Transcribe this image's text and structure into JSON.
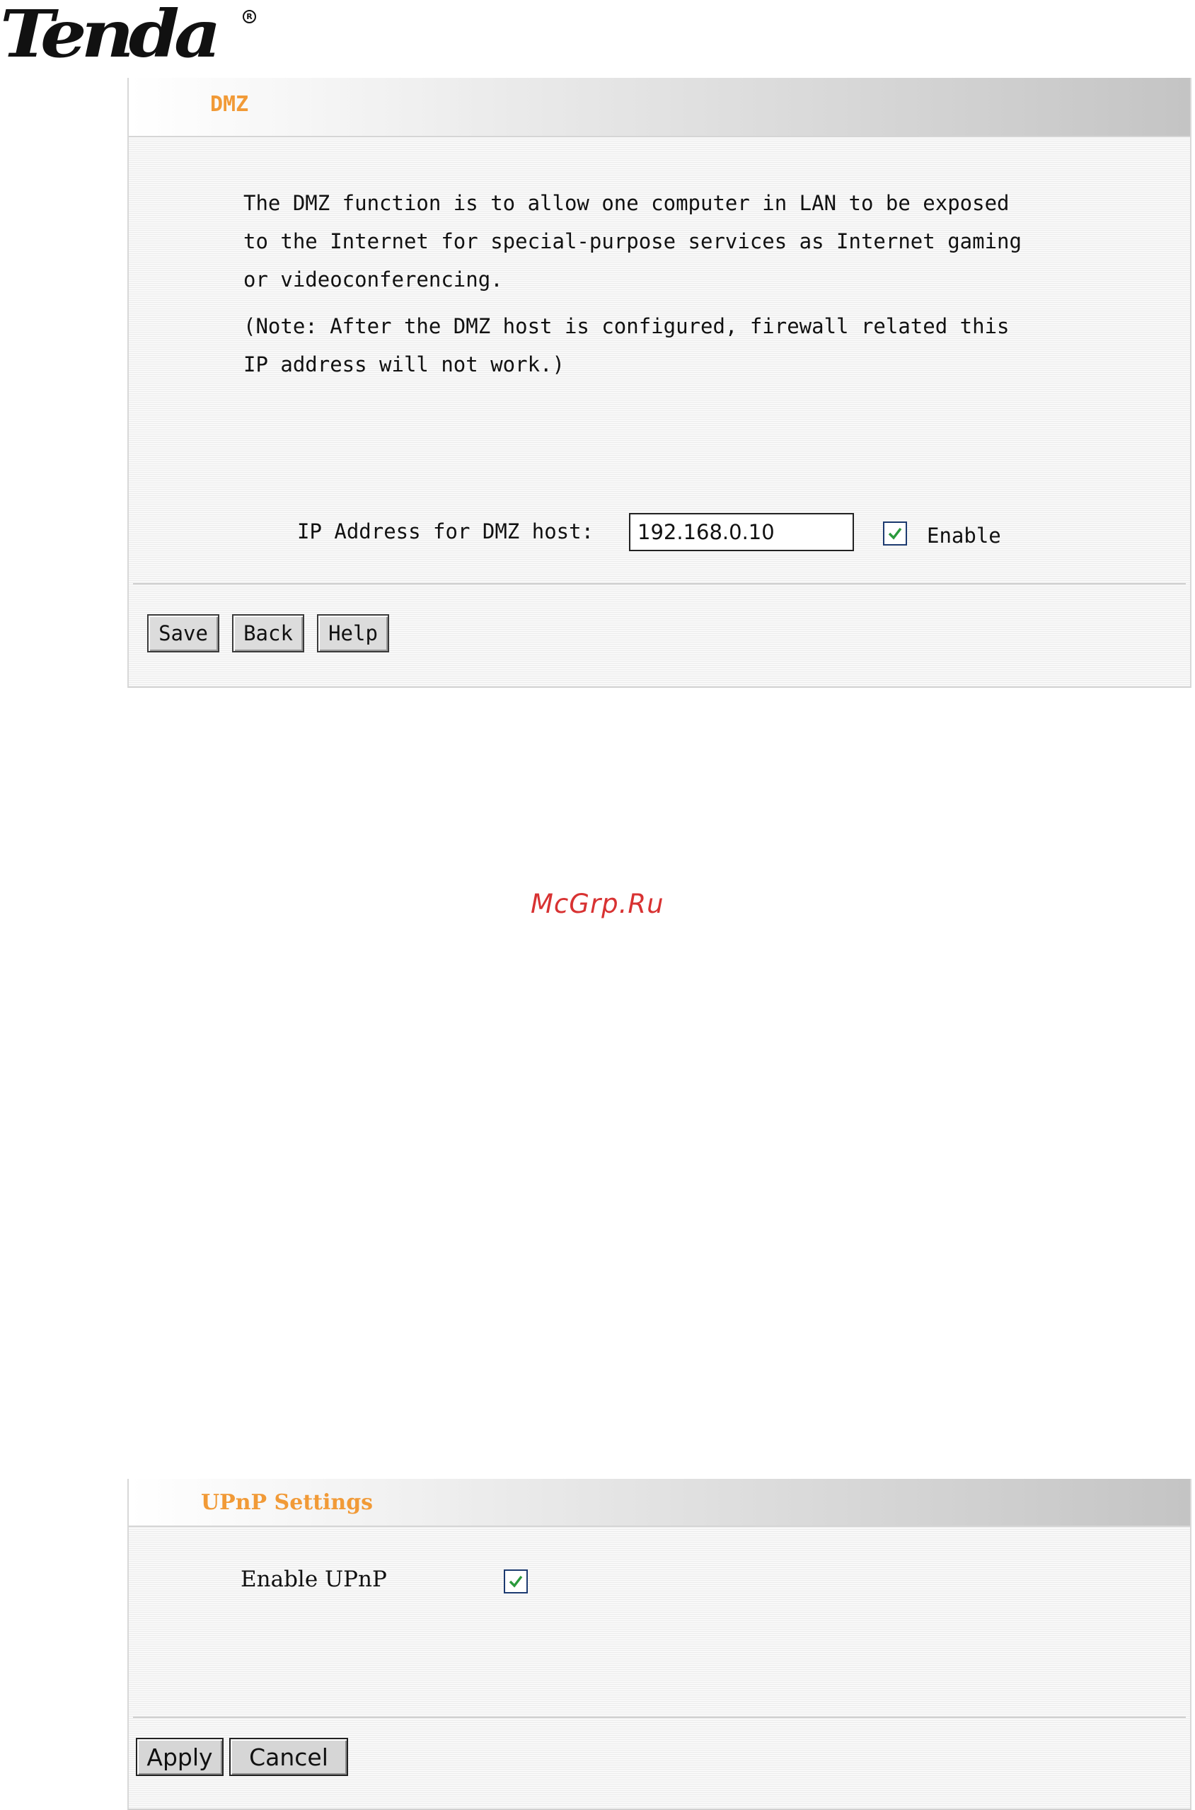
{
  "brand": {
    "logo_text": "Tenda",
    "registered_mark": "R"
  },
  "dmz": {
    "title": "DMZ",
    "description": "The DMZ function is to allow one computer in LAN to be exposed\nto the Internet for special-purpose services as Internet gaming\nor videoconferencing.",
    "note": "(Note: After the DMZ host is configured, firewall related this\nIP address will not work.)",
    "ip_label": "IP Address for DMZ host:",
    "ip_value": "192.168.0.10",
    "enable_label": "Enable",
    "enable_checked": true,
    "buttons": {
      "save": "Save",
      "back": "Back",
      "help": "Help"
    }
  },
  "watermark": "McGrp.Ru",
  "upnp": {
    "title": "UPnP Settings",
    "enable_label": "Enable UPnP",
    "enable_checked": true,
    "buttons": {
      "apply": "Apply",
      "cancel": "Cancel"
    }
  },
  "colors": {
    "title_accent": "#f19a37",
    "watermark": "#d83232",
    "checkmark": "#2a9a3c",
    "checkbox_border": "#1c3a70"
  }
}
